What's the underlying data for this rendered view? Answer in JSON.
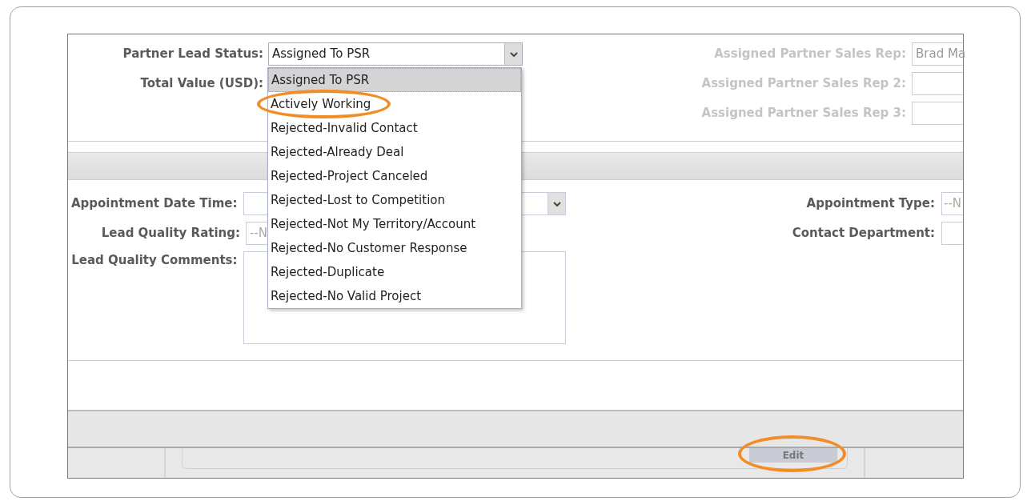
{
  "top_form": {
    "status": {
      "label": "Partner Lead Status:",
      "value": "Assigned To PSR"
    },
    "total_value": {
      "label": "Total Value (USD):"
    },
    "reps": [
      {
        "label": "Assigned Partner Sales Rep:",
        "value": "Brad Ma",
        "disabled": true
      },
      {
        "label": "Assigned Partner Sales Rep 2:",
        "disabled": true
      },
      {
        "label": "Assigned Partner Sales Rep 3:",
        "disabled": true
      }
    ]
  },
  "status_options": [
    {
      "label": "Assigned To PSR",
      "selected": true,
      "circled": false
    },
    {
      "label": "Actively Working",
      "selected": false,
      "circled": true
    },
    {
      "label": "Rejected-Invalid Contact",
      "selected": false,
      "circled": false
    },
    {
      "label": "Rejected-Already Deal",
      "selected": false,
      "circled": false
    },
    {
      "label": "Rejected-Project Canceled",
      "selected": false,
      "circled": false
    },
    {
      "label": "Rejected-Lost to Competition",
      "selected": false,
      "circled": false
    },
    {
      "label": "Rejected-Not My Territory/Account",
      "selected": false,
      "circled": false
    },
    {
      "label": "Rejected-No Customer Response",
      "selected": false,
      "circled": false
    },
    {
      "label": "Rejected-Duplicate",
      "selected": false,
      "circled": false
    },
    {
      "label": "Rejected-No Valid Project",
      "selected": false,
      "circled": false
    }
  ],
  "appointment_form": {
    "date_time": {
      "label": "Appointment Date Time:"
    },
    "rating": {
      "label": "Lead Quality Rating:",
      "value": "--N"
    },
    "comments": {
      "label": "Lead Quality Comments:"
    },
    "type": {
      "label": "Appointment Type:",
      "value": "--N"
    },
    "department": {
      "label": "Contact Department:"
    }
  },
  "footer": {
    "edit_button": {
      "label": "Edit",
      "circled": true
    }
  }
}
